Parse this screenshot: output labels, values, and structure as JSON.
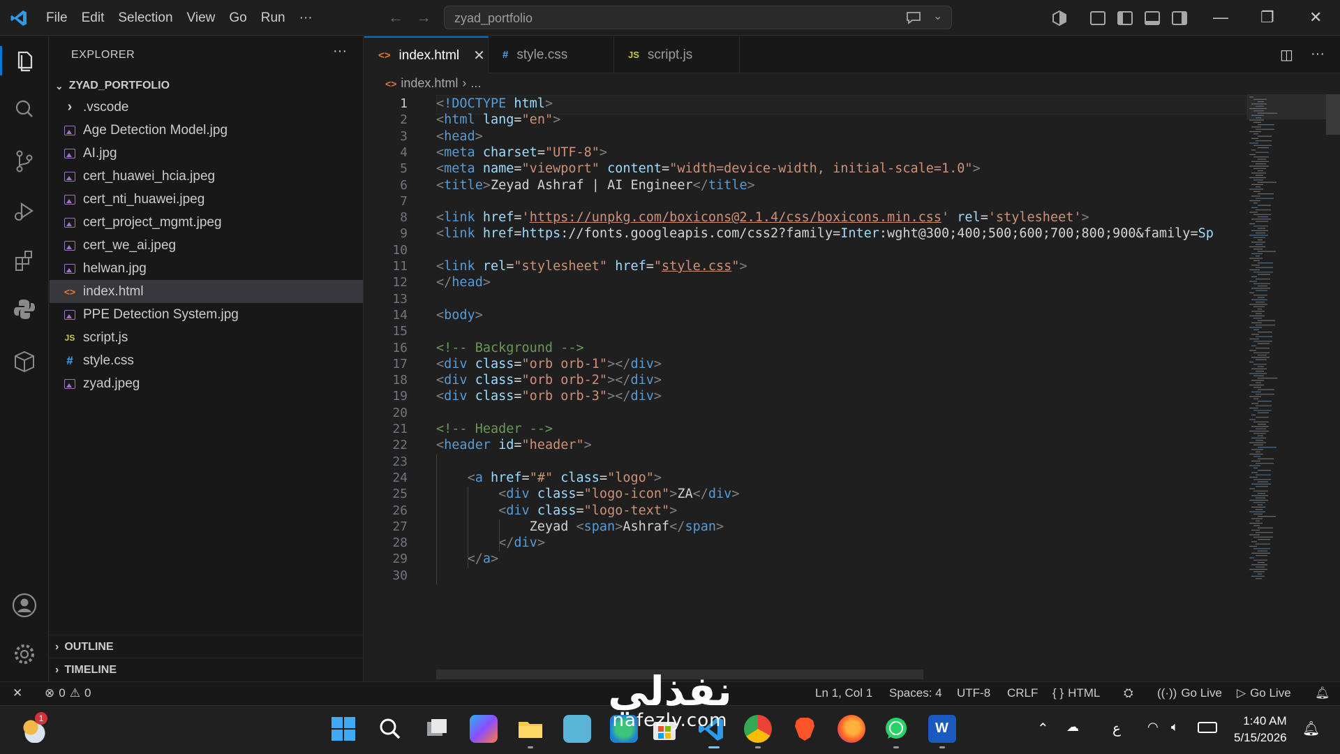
{
  "titlebar": {
    "menu": [
      "File",
      "Edit",
      "Selection",
      "View",
      "Go",
      "Run",
      "···"
    ],
    "search_text": "zyad_portfolio"
  },
  "sidebar": {
    "title": "EXPLORER",
    "folder": "ZYAD_PORTFOLIO",
    "items": [
      {
        "label": ".vscode",
        "kind": "folder"
      },
      {
        "label": "Age Detection Model.jpg",
        "kind": "image"
      },
      {
        "label": "AI.jpg",
        "kind": "image"
      },
      {
        "label": "cert_huawei_hcia.jpeg",
        "kind": "image"
      },
      {
        "label": "cert_nti_huawei.jpeg",
        "kind": "image"
      },
      {
        "label": "cert_project_mgmt.jpeg",
        "kind": "image"
      },
      {
        "label": "cert_we_ai.jpeg",
        "kind": "image"
      },
      {
        "label": "helwan.jpg",
        "kind": "image"
      },
      {
        "label": "index.html",
        "kind": "html"
      },
      {
        "label": "PPE Detection System.jpg",
        "kind": "image"
      },
      {
        "label": "script.js",
        "kind": "js"
      },
      {
        "label": "style.css",
        "kind": "css"
      },
      {
        "label": "zyad.jpeg",
        "kind": "image"
      }
    ],
    "outline": "OUTLINE",
    "timeline": "TIMELINE"
  },
  "tabs": [
    {
      "label": "index.html",
      "icon": "html-icon",
      "icon_text": "<>"
    },
    {
      "label": "style.css",
      "icon": "css-icon",
      "icon_text": "#"
    },
    {
      "label": "script.js",
      "icon": "js-icon",
      "icon_text": "JS"
    }
  ],
  "breadcrumb": {
    "file": "index.html",
    "rest": "..."
  },
  "code_lines": [
    "<!DOCTYPE html>",
    "<html lang=\"en\">",
    "<head>",
    "<meta charset=\"UTF-8\">",
    "<meta name=\"viewport\" content=\"width=device-width, initial-scale=1.0\">",
    "<title>Zeyad Ashraf | AI Engineer</title>",
    "",
    "<link href='https://unpkg.com/boxicons@2.1.4/css/boxicons.min.css' rel='stylesheet'>",
    "<link href=\"https://fonts.googleapis.com/css2?family=Inter:wght@300;400;500;600;700;800;900&family=Sp",
    "",
    "<link rel=\"stylesheet\" href=\"style.css\">",
    "</head>",
    "",
    "<body>",
    "",
    "<!-- Background -->",
    "<div class=\"orb orb-1\"></div>",
    "<div class=\"orb orb-2\"></div>",
    "<div class=\"orb orb-3\"></div>",
    "",
    "<!-- Header -->",
    "<header id=\"header\">",
    "",
    "    <a href=\"#\" class=\"logo\">",
    "        <div class=\"logo-icon\">ZA</div>",
    "        <div class=\"logo-text\">",
    "            Zeyad <span>Ashraf</span>",
    "        </div>",
    "    </a>"
  ],
  "status": {
    "errors": "0",
    "warnings": "0",
    "position": "Ln 1, Col 1",
    "spaces": "Spaces: 4",
    "encoding": "UTF-8",
    "eol": "CRLF",
    "language": "HTML",
    "golive1": "Go Live",
    "golive2": "Go Live"
  },
  "taskbar": {
    "weather_badge": "1",
    "lang": "ع",
    "time": "1:40 AM",
    "date": "5/15/2026"
  },
  "watermark": {
    "arabic": "نفذلي",
    "latin": "nafezly.com"
  },
  "colors": {
    "accent": "#0078d4",
    "tag": "#569cd6",
    "attr": "#9cdcfe",
    "string": "#ce9178",
    "comment": "#6a9955"
  }
}
